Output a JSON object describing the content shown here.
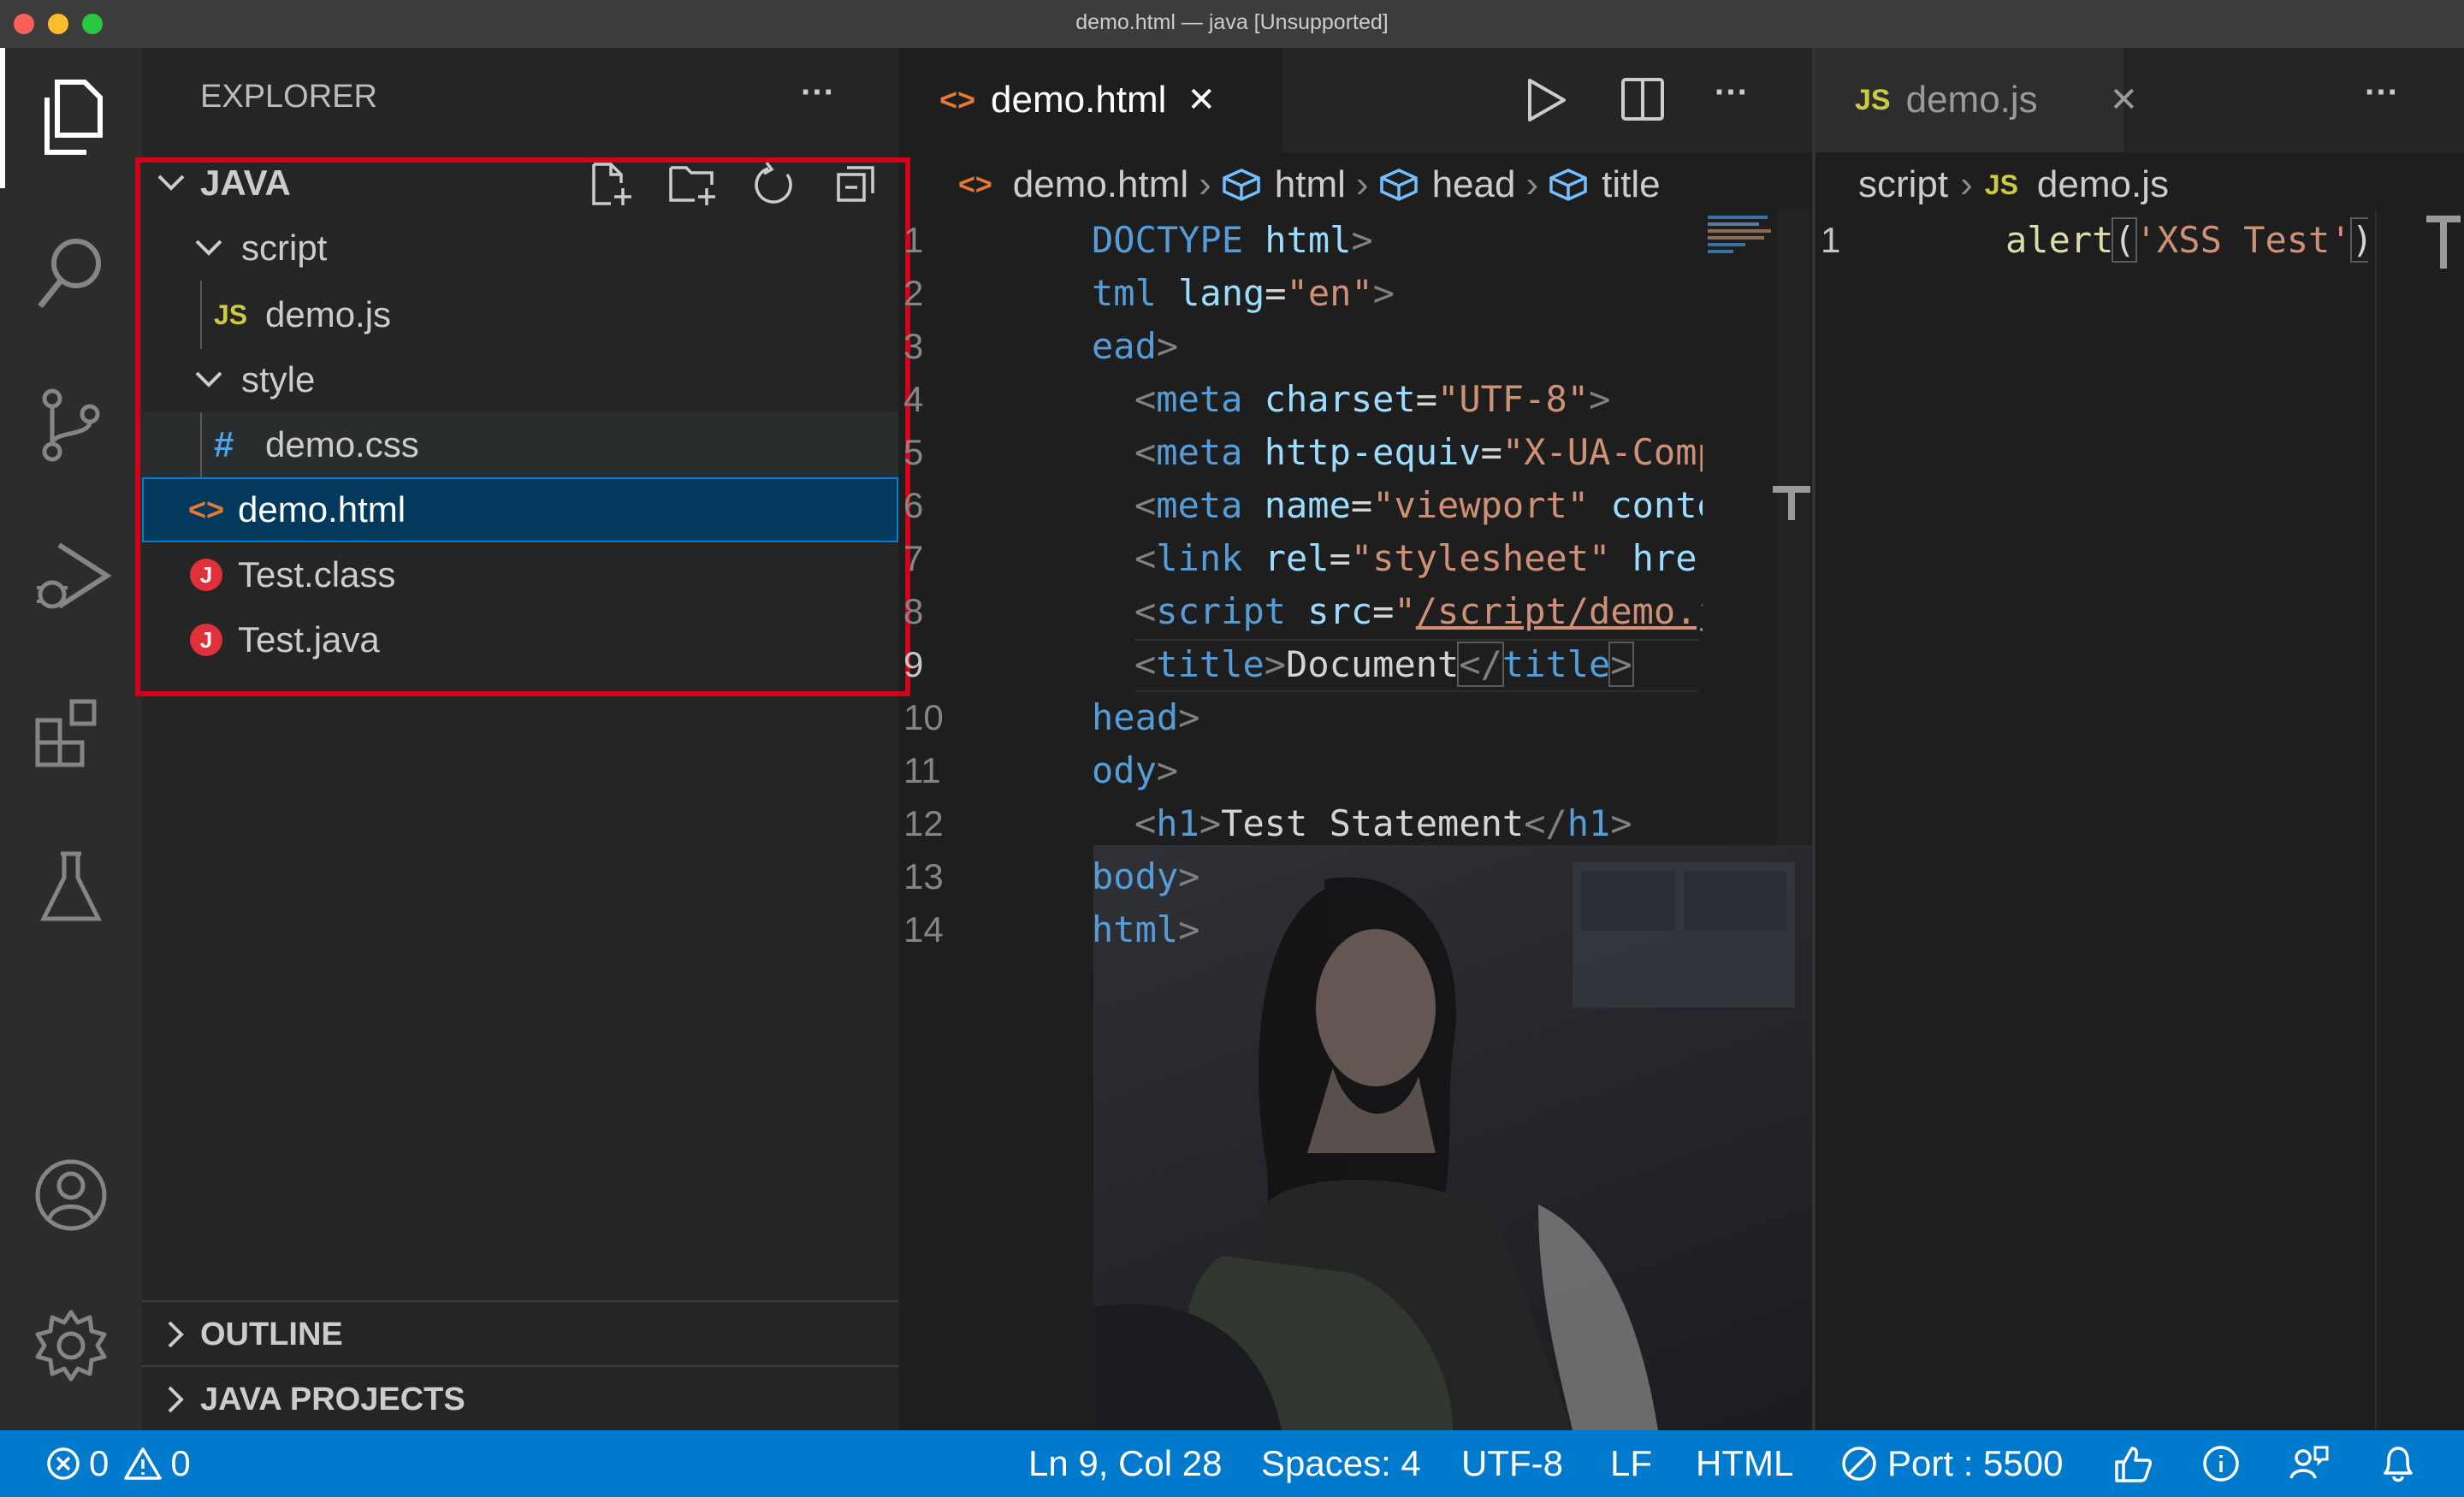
{
  "window": {
    "title": "demo.html — java [Unsupported]"
  },
  "activity_bar": {
    "items": [
      "explorer-icon",
      "search-icon",
      "source-control-icon",
      "run-debug-icon",
      "extensions-icon",
      "testing-icon",
      "account-icon",
      "settings-gear-icon"
    ]
  },
  "sidebar": {
    "title": "EXPLORER",
    "more": "···",
    "folder": "JAVA",
    "tree": [
      {
        "label": "script",
        "type": "folder"
      },
      {
        "label": "demo.js",
        "type": "js",
        "icon_text": "JS"
      },
      {
        "label": "style",
        "type": "folder"
      },
      {
        "label": "demo.css",
        "type": "css",
        "icon_text": "#"
      },
      {
        "label": "demo.html",
        "type": "html",
        "icon_text": "<>",
        "selected": true
      },
      {
        "label": "Test.class",
        "type": "java",
        "icon_text": "J"
      },
      {
        "label": "Test.java",
        "type": "java",
        "icon_text": "J"
      }
    ],
    "sections": {
      "outline": "OUTLINE",
      "java_projects": "JAVA PROJECTS"
    }
  },
  "editor_left": {
    "tab": {
      "icon_text": "<>",
      "label": "demo.html",
      "close": "✕"
    },
    "more": "···",
    "breadcrumb": [
      "demo.html",
      "html",
      "head",
      "title"
    ],
    "line_numbers": [
      "1",
      "2",
      "3",
      "4",
      "5",
      "6",
      "7",
      "8",
      "9",
      "10",
      "11",
      "12",
      "13",
      "14"
    ],
    "current_line": "9",
    "lines": {
      "l1a": "DOCTYPE",
      "l1b": " html",
      "l1c": ">",
      "l2a": "tml",
      "l2b": " lang",
      "l2c": "=",
      "l2d": "\"en\"",
      "l2e": ">",
      "l3a": "ead",
      "l3b": ">",
      "l4a": "<",
      "l4b": "meta",
      "l4c": " charset",
      "l4d": "=",
      "l4e": "\"UTF-8\"",
      "l4f": ">",
      "l5a": "<",
      "l5b": "meta",
      "l5c": " http-equiv",
      "l5d": "=",
      "l5e": "\"X-UA-Comp",
      "l6a": "<",
      "l6b": "meta",
      "l6c": " name",
      "l6d": "=",
      "l6e": "\"viewport\"",
      "l6f": " conte",
      "l7a": "<",
      "l7b": "link",
      "l7c": " rel",
      "l7d": "=",
      "l7e": "\"stylesheet\"",
      "l7f": " hre",
      "l8a": "<",
      "l8b": "script",
      "l8c": " src",
      "l8d": "=",
      "l8e": "\"",
      "l8f": "/script/demo.j",
      "l9a": "<",
      "l9b": "title",
      "l9c": ">",
      "l9d": "Document",
      "l9e": "</",
      "l9f": "title",
      "l9g": ">",
      "l10a": "head",
      "l10b": ">",
      "l11a": "ody",
      "l11b": ">",
      "l12a": "<",
      "l12b": "h1",
      "l12c": ">",
      "l12d": "Test Statement",
      "l12e": "</",
      "l12f": "h1",
      "l12g": ">",
      "l13a": "body",
      "l13b": ">",
      "l14a": "html",
      "l14b": ">"
    }
  },
  "editor_right": {
    "tab": {
      "icon_text": "JS",
      "label": "demo.js",
      "close": "✕"
    },
    "more": "···",
    "breadcrumb": [
      "script",
      "demo.js"
    ],
    "breadcrumb_icon_text": "JS",
    "line_number": "1",
    "code": {
      "fn": "alert",
      "open": "(",
      "str": "'XSS Test'",
      "close": ")"
    }
  },
  "status_bar": {
    "errors": "0",
    "warnings": "0",
    "position": "Ln 9, Col 28",
    "spaces": "Spaces: 4",
    "encoding": "UTF-8",
    "eol": "LF",
    "language": "HTML",
    "port": "Port : 5500"
  },
  "colors": {
    "accent": "#007acc",
    "highlight_box": "#d0021b",
    "selected_row": "#04395e",
    "java_icon": "#e0303a",
    "js_icon": "#cbcb41",
    "css_icon": "#42a5f5",
    "html_icon": "#e37933"
  }
}
